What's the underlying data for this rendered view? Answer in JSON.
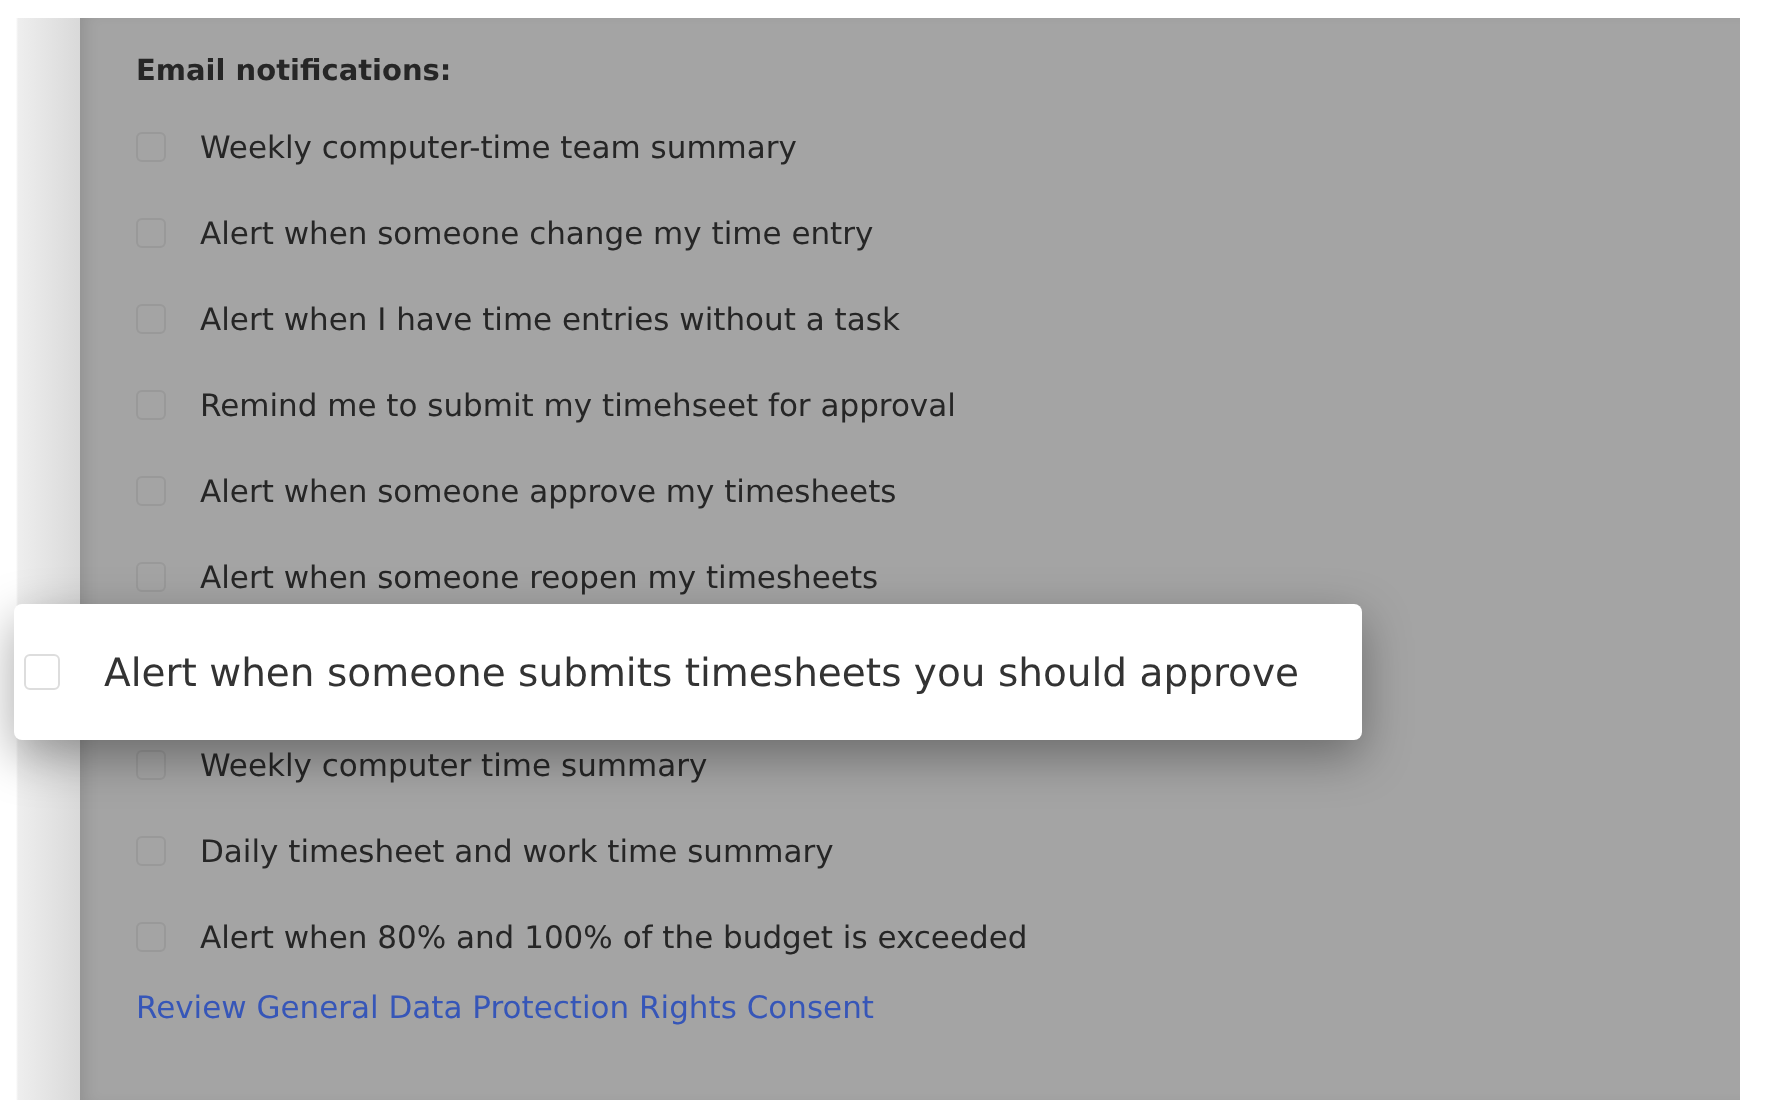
{
  "section": {
    "title": "Email notifications:"
  },
  "options": [
    {
      "label": "Weekly computer-time team summary",
      "checked": false,
      "kind": "normal"
    },
    {
      "label": "Alert when someone change my time entry",
      "checked": false,
      "kind": "normal"
    },
    {
      "label": "Alert when I have time entries without a task",
      "checked": false,
      "kind": "normal"
    },
    {
      "label": "Remind me to submit my timehseet for approval",
      "checked": false,
      "kind": "normal"
    },
    {
      "label": "Alert when someone approve my timesheets",
      "checked": false,
      "kind": "normal"
    },
    {
      "label": "Alert when someone reopen my timesheets",
      "checked": false,
      "kind": "normal"
    },
    {
      "label": "Alert when someone submits timesheets you should approve",
      "checked": false,
      "kind": "highlighted"
    },
    {
      "label": "Weekly computer time summary",
      "checked": false,
      "kind": "normal"
    },
    {
      "label": "Daily timesheet and work time summary",
      "checked": false,
      "kind": "normal"
    },
    {
      "label": "Alert when 80% and 100% of the budget is exceeded",
      "checked": false,
      "kind": "normal"
    }
  ],
  "link": "Review General Data Protection Rights Consent"
}
